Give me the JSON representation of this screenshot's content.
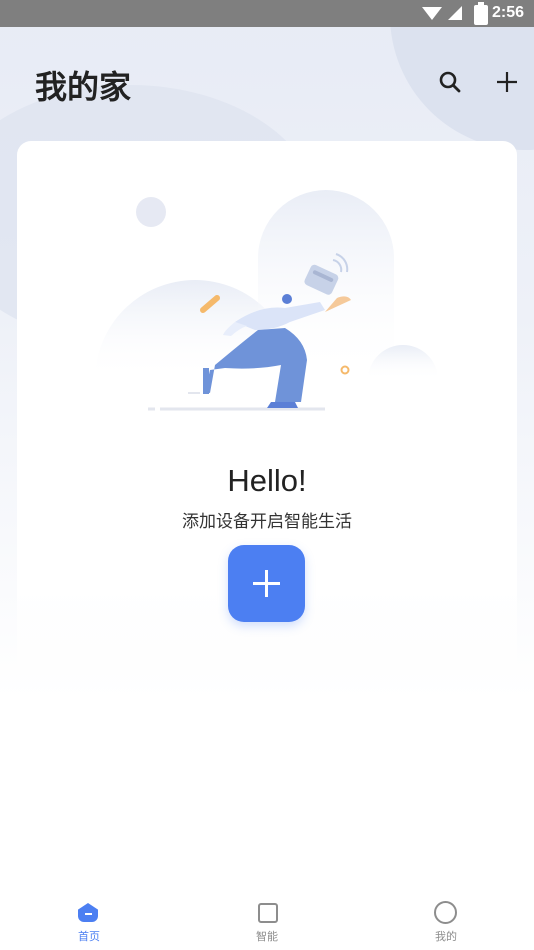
{
  "status_bar": {
    "time": "2:56",
    "icons": [
      "wifi-icon",
      "cellular-icon",
      "battery-icon"
    ]
  },
  "header": {
    "title": "我的家",
    "actions": [
      "search-icon",
      "plus-icon"
    ]
  },
  "empty_state": {
    "heading": "Hello!",
    "subtitle": "添加设备开启智能生活",
    "button_icon": "plus-icon"
  },
  "tabs": [
    {
      "label": "首页",
      "icon": "home-icon",
      "active": true
    },
    {
      "label": "智能",
      "icon": "smart-icon",
      "active": false
    },
    {
      "label": "我的",
      "icon": "profile-icon",
      "active": false
    }
  ],
  "colors": {
    "accent": "#4c7ff2",
    "title_text": "#222222",
    "inactive_tab": "#8d8d8d"
  }
}
